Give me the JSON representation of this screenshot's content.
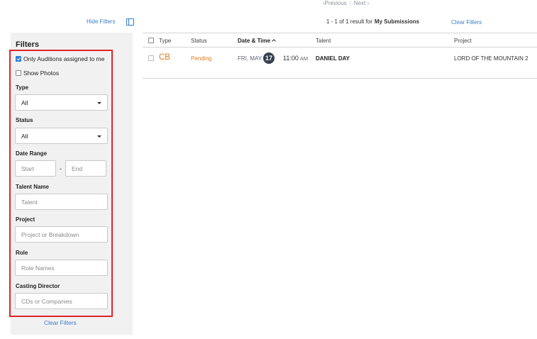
{
  "pagination": {
    "previous": "Previous",
    "next": "Next"
  },
  "toolbar": {
    "hide_filters": "Hide Filters",
    "result_count": "1 - 1 of 1 result for",
    "result_scope": "My Submissions",
    "clear_filters": "Clear Filters"
  },
  "filters": {
    "title": "Filters",
    "only_assigned": {
      "label": "Only Auditions assigned to me",
      "checked": true
    },
    "show_photos": {
      "label": "Show Photos",
      "checked": false
    },
    "type": {
      "label": "Type",
      "value": "All"
    },
    "status": {
      "label": "Status",
      "value": "All"
    },
    "date_range": {
      "label": "Date Range",
      "start_placeholder": "Start",
      "separator": "-",
      "end_placeholder": "End"
    },
    "talent_name": {
      "label": "Talent Name",
      "placeholder": "Talent"
    },
    "project": {
      "label": "Project",
      "placeholder": "Project or Breakdown"
    },
    "role": {
      "label": "Role",
      "placeholder": "Role Names"
    },
    "casting_director": {
      "label": "Casting Director",
      "placeholder": "CDs or Companies"
    },
    "clear_filters": "Clear Filters"
  },
  "table": {
    "columns": {
      "type": "Type",
      "status": "Status",
      "date_time": "Date & Time",
      "talent": "Talent",
      "project": "Project"
    },
    "rows": [
      {
        "type": "CB",
        "status": "Pending",
        "date_prefix": "FRI, MAY",
        "day": "17",
        "time": "11:00",
        "ampm": "AM",
        "talent": "DANIEL DAY",
        "project": "LORD OF THE MOUNTAIN 2"
      }
    ]
  },
  "colors": {
    "accent_blue": "#2f7dd1",
    "link_blue": "#3a7fc8",
    "pending_orange": "#e07b1f",
    "highlight_red": "#e1242a",
    "badge_dark": "#34404f"
  }
}
